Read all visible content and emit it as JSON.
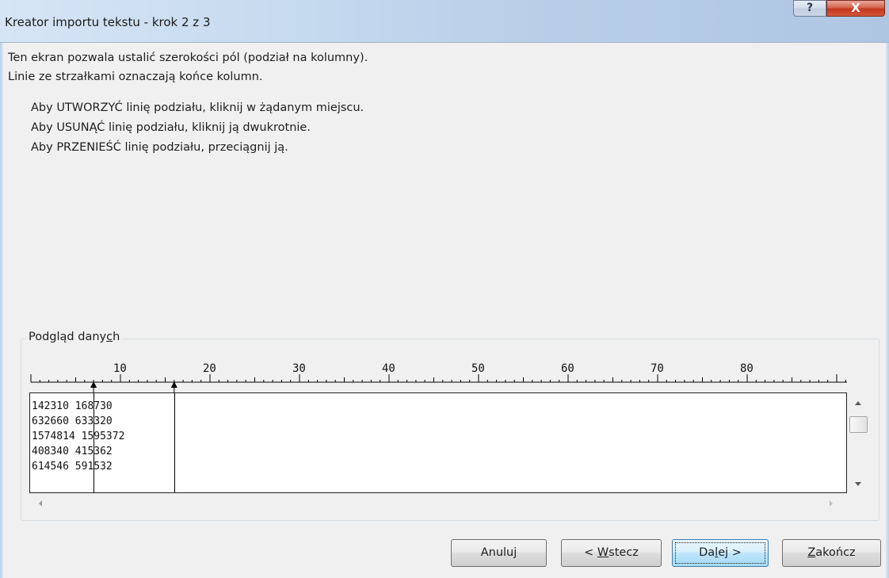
{
  "window": {
    "title": "Kreator importu tekstu - krok 2 z 3",
    "help_label": "?",
    "close_label": "X"
  },
  "description": {
    "line1": "Ten ekran pozwala ustalić szerokości pól (podział na kolumny).",
    "line2": "Linie ze strzałkami oznaczają końce kolumn."
  },
  "instructions": {
    "create": "Aby UTWORZYĆ linię podziału, kliknij w żądanym miejscu.",
    "delete": "Aby USUNĄĆ linię podziału, kliknij ją dwukrotnie.",
    "move": "Aby PRZENIEŚĆ linię podziału, przeciągnij ją."
  },
  "preview": {
    "group_label_prefix": "Podgląd dany",
    "group_label_accel": "c",
    "group_label_suffix": "h",
    "ruler_labels": [
      "10",
      "20",
      "30",
      "40",
      "50",
      "60",
      "70",
      "80"
    ],
    "break_columns": [
      7,
      16
    ],
    "rows": [
      "142310 168730",
      "632660 633320",
      "1574814 1595372",
      "408340 415362",
      "614546 591532"
    ]
  },
  "buttons": {
    "cancel": "Anuluj",
    "back_prefix": "< ",
    "back_accel": "W",
    "back_suffix": "stecz",
    "next_prefix": "Da",
    "next_accel": "l",
    "next_suffix": "ej >",
    "finish_accel": "Z",
    "finish_suffix": "akończ"
  }
}
